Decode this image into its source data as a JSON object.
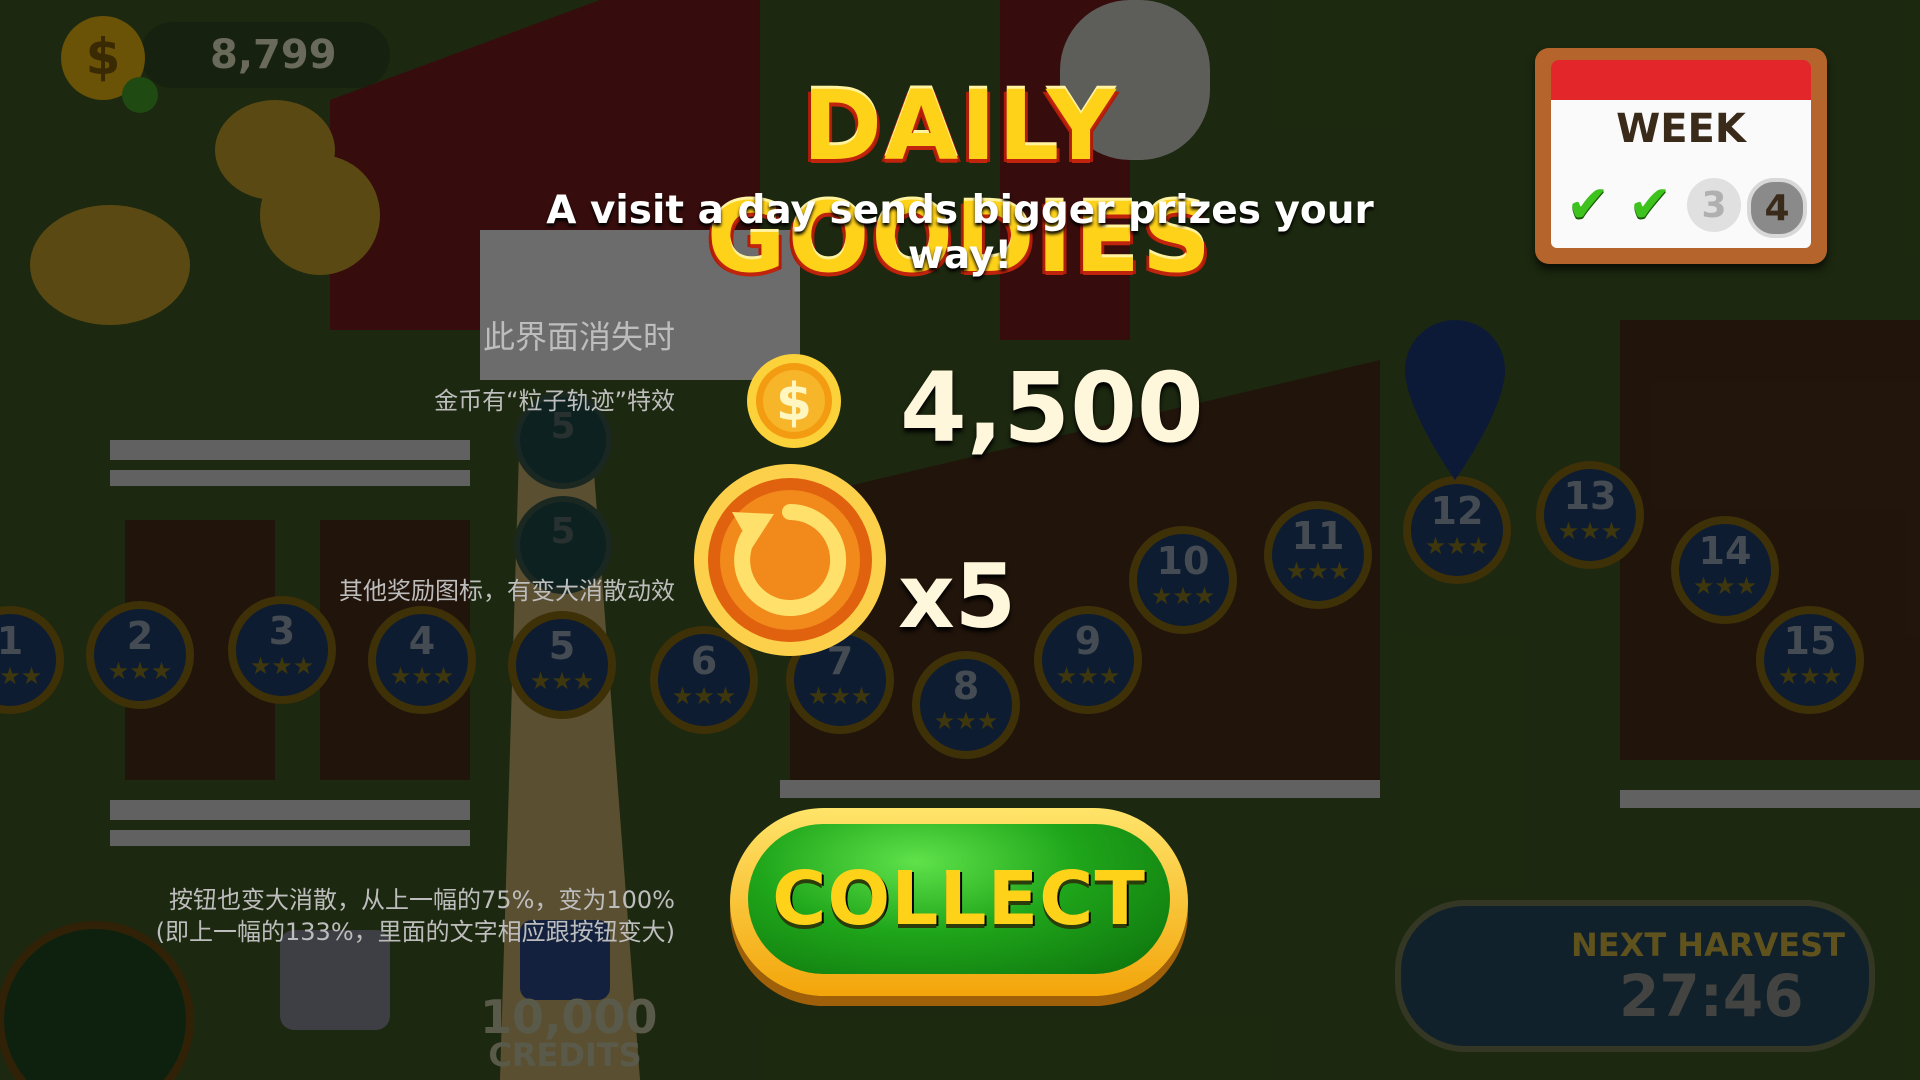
{
  "hud": {
    "coin_balance": "8,799",
    "next_harvest_label": "NEXT HARVEST",
    "next_harvest_time": "27:46",
    "credits_amount": "10,000",
    "credits_label": "CREDITS"
  },
  "popup": {
    "title": "DAILY GOODIES",
    "subtitle": "A visit a day sends bigger prizes your way!",
    "coin_reward": "4,500",
    "multiplier": "x5",
    "collect_label": "COLLECT"
  },
  "calendar": {
    "label": "WEEK",
    "days": [
      {
        "state": "done"
      },
      {
        "state": "done"
      },
      {
        "state": "future",
        "label": "3"
      },
      {
        "state": "today",
        "label": "4"
      }
    ]
  },
  "notes": {
    "note_1": "此界面消失时",
    "note_2": "金币有“粒子轨迹”特效",
    "note_3": "其他奖励图标，有变大消散动效",
    "note_4_line1": "按钮也变大消散，从上一幅的75%，变为100%",
    "note_4_line2": "(即上一幅的133%，里面的文字相应跟按钮变大)"
  },
  "map": {
    "level_nodes": [
      "1",
      "2",
      "3",
      "4",
      "5",
      "6",
      "7",
      "8",
      "9",
      "10",
      "11",
      "12",
      "13",
      "14",
      "15"
    ],
    "upper_nodes": [
      "5",
      "5"
    ]
  },
  "colors": {
    "title": "#ffd21a",
    "collect_green": "#1fa51a",
    "coin_gold": "#f6b400",
    "calendar_red": "#e3262a"
  }
}
